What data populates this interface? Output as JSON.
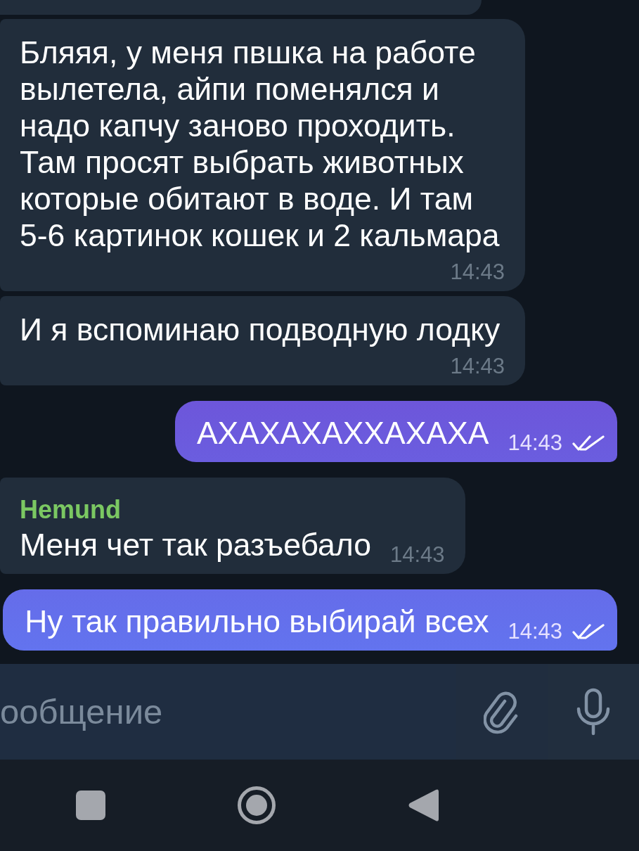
{
  "messages": [
    {
      "kind": "incoming",
      "cut_off": true
    },
    {
      "kind": "incoming",
      "cut_off": false,
      "text": "Бляяя, у меня пвшка на работе вылетела, айпи поменялся и надо капчу заново проходить. Там просят выбрать животных которые обитают в воде. И там 5-6 картинок кошек и 2 кальмара",
      "time": "14:43"
    },
    {
      "kind": "incoming",
      "cut_off": false,
      "text": "И я вспоминаю подводную лодку",
      "time": "14:43"
    },
    {
      "kind": "outgoing",
      "cut_off": false,
      "text": "АХАХАХАХХАХАХА",
      "time": "14:43",
      "read": true
    },
    {
      "kind": "incoming",
      "cut_off": false,
      "sender": "Hemund",
      "text": "Меня чет так разъебало",
      "time": "14:43"
    },
    {
      "kind": "outgoing",
      "cut_off": false,
      "text": "Ну так правильно выбирай всех",
      "time": "14:43",
      "read": true
    }
  ],
  "composer": {
    "placeholder": "ообщение"
  }
}
